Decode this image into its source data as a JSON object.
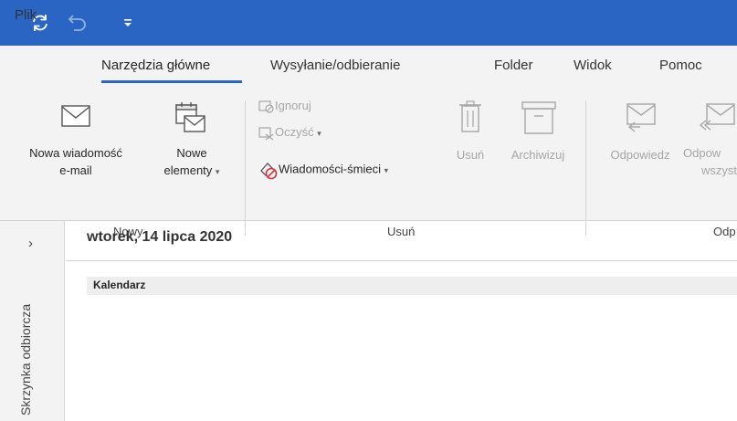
{
  "quick_access": {
    "icons": [
      "sync-icon",
      "undo-icon",
      "customize-qat-icon"
    ]
  },
  "tabs": {
    "file": "Plik",
    "home": "Narzędzia główne",
    "send_receive": "Wysyłanie/odbieranie",
    "folder": "Folder",
    "view": "Widok",
    "help": "Pomoc"
  },
  "ribbon": {
    "new_email": [
      "Nowa wiadomość",
      "e-mail"
    ],
    "new_items": [
      "Nowe",
      "elementy"
    ],
    "group_new": "Nowy",
    "ignore": "Ignoruj",
    "cleanup": "Oczyść",
    "junk": "Wiadomości-śmieci",
    "delete": "Usuń",
    "archive": "Archiwizuj",
    "group_delete": "Usuń",
    "reply": "Odpowiedz",
    "reply_all": [
      "Odpow",
      "wszyst"
    ],
    "group_respond": "Odp"
  },
  "left_pane": {
    "label": "Skrzynka odbiorcza"
  },
  "main": {
    "date": "wtorek, 14 lipca 2020",
    "calendar_header": "Kalendarz"
  },
  "colors": {
    "title_bar": "#2b65c3",
    "ribbon_bg": "#f3f3f3",
    "file_tab_highlight": "#d9262e",
    "active_tab_underline": "#2b65c3"
  }
}
